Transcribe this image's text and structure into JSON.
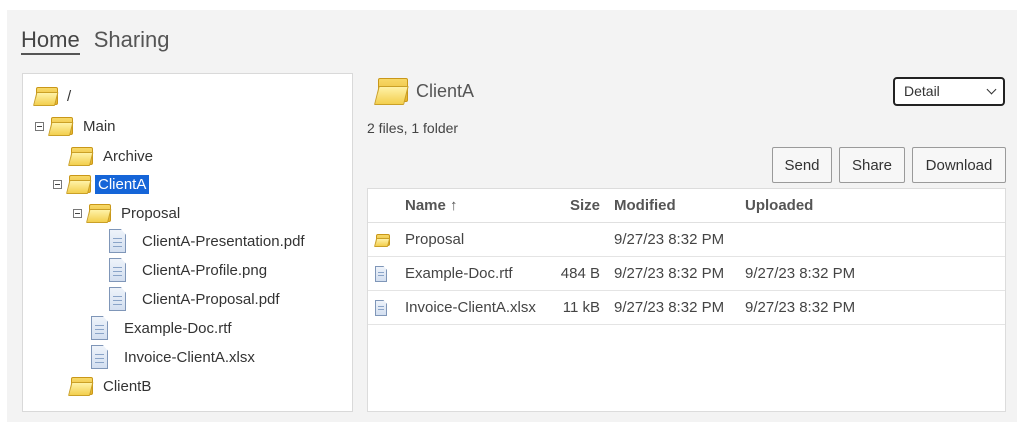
{
  "nav": {
    "home": "Home",
    "sharing": "Sharing"
  },
  "tree": {
    "root": "/",
    "main": "Main",
    "archive": "Archive",
    "clientA": "ClientA",
    "proposal": "Proposal",
    "file_presentation": "ClientA-Presentation.pdf",
    "file_profile": "ClientA-Profile.png",
    "file_proposal": "ClientA-Proposal.pdf",
    "file_example": "Example-Doc.rtf",
    "file_invoice": "Invoice-ClientA.xlsx",
    "clientB": "ClientB"
  },
  "main": {
    "folder_title": "ClientA",
    "summary": "2 files, 1 folder",
    "view_select": "Detail",
    "buttons": {
      "send": "Send",
      "share": "Share",
      "download": "Download"
    },
    "columns": {
      "name": "Name ↑",
      "size": "Size",
      "modified": "Modified",
      "uploaded": "Uploaded"
    },
    "rows": [
      {
        "name": "Proposal",
        "size": "",
        "modified": "9/27/23 8:32 PM",
        "uploaded": ""
      },
      {
        "name": "Example-Doc.rtf",
        "size": "484 B",
        "modified": "9/27/23 8:32 PM",
        "uploaded": "9/27/23 8:32 PM"
      },
      {
        "name": "Invoice-ClientA.xlsx",
        "size": "11 kB",
        "modified": "9/27/23 8:32 PM",
        "uploaded": "9/27/23 8:32 PM"
      }
    ]
  },
  "colors": {
    "selection": "#1565d8",
    "folder": "#f3cf4e",
    "panel_bg": "#f3f3f3"
  }
}
